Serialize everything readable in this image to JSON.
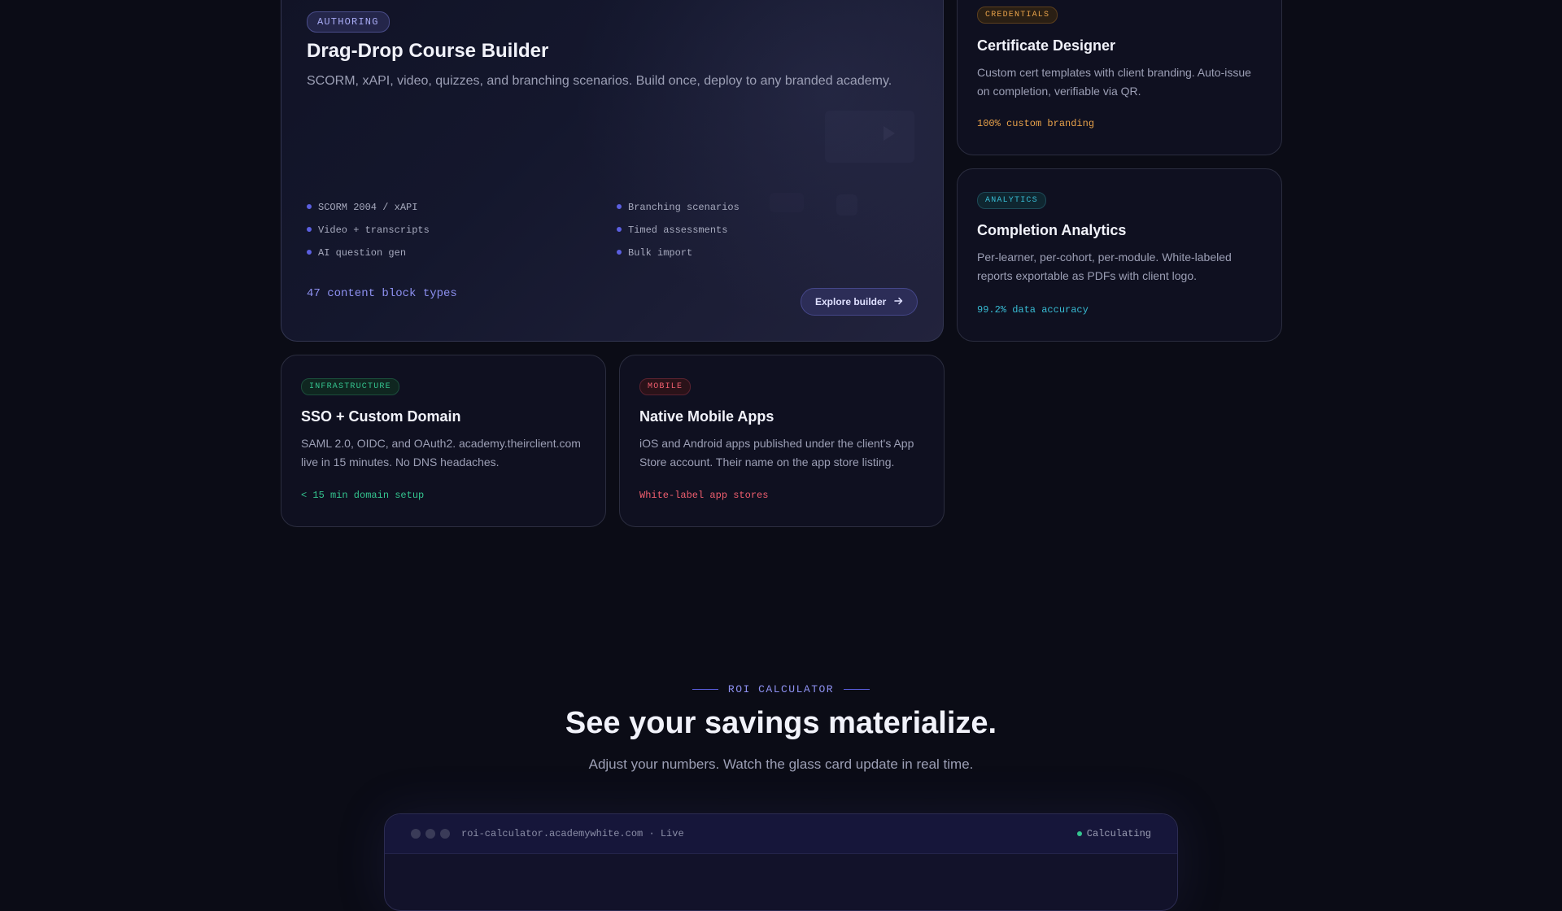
{
  "authoring": {
    "tag": "AUTHORING",
    "title": "Drag-Drop Course Builder",
    "description": "SCORM, xAPI, video, quizzes, and branching scenarios. Build once, deploy to any branded academy.",
    "features": [
      "SCORM 2004 / xAPI",
      "Branching scenarios",
      "Video + transcripts",
      "Timed assessments",
      "AI question gen",
      "Bulk import"
    ],
    "stat": "47 content block types",
    "button_label": "Explore builder"
  },
  "credentials": {
    "tag": "CREDENTIALS",
    "title": "Certificate Designer",
    "description": "Custom cert templates with client branding. Auto-issue on completion, verifiable via QR.",
    "stat": "100% custom branding"
  },
  "analytics": {
    "tag": "ANALYTICS",
    "title": "Completion Analytics",
    "description": "Per-learner, per-cohort, per-module. White-labeled reports exportable as PDFs with client logo.",
    "stat": "99.2% data accuracy"
  },
  "infrastructure": {
    "tag": "INFRASTRUCTURE",
    "title": "SSO + Custom Domain",
    "description": "SAML 2.0, OIDC, and OAuth2. academy.theirclient.com live in 15 minutes. No DNS headaches.",
    "stat": "< 15 min domain setup"
  },
  "mobile": {
    "tag": "MOBILE",
    "title": "Native Mobile Apps",
    "description": "iOS and Android apps published under the client's App Store account. Their name on the app store listing.",
    "stat": "White-label app stores"
  },
  "roi": {
    "label": "ROI CALCULATOR",
    "heading": "See your savings materialize.",
    "subheading": "Adjust your numbers. Watch the glass card update in real time.",
    "window_url": "roi-calculator.academywhite.com · Live",
    "status": "Calculating"
  },
  "colors": {
    "accent": "#5b5fe0",
    "amber": "#e8a24a",
    "cyan": "#38bcd4",
    "green": "#34c48f",
    "red": "#ef5e6e"
  }
}
